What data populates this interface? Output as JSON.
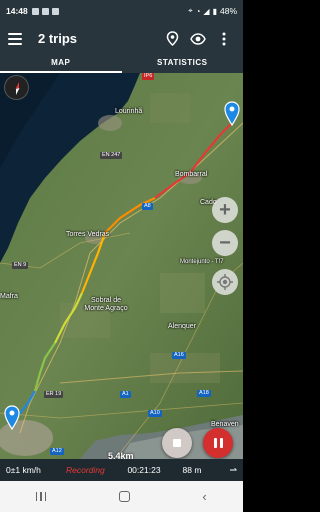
{
  "status_bar": {
    "time": "14:48",
    "battery": "48%"
  },
  "app_bar": {
    "title": "2 trips",
    "icons": [
      "menu-icon",
      "marker-icon",
      "eye-icon",
      "more-vert-icon"
    ]
  },
  "tabs": [
    {
      "label": "MAP",
      "active": true
    },
    {
      "label": "STATISTICS",
      "active": false
    }
  ],
  "map": {
    "labels": {
      "lourinha": "Lourinhã",
      "bombarral": "Bombarral",
      "cado": "Cado",
      "torres_vedras": "Torres Vedras",
      "montejunto": "Montejunto - T!7",
      "sobral": "Sobral de Monte Agraço",
      "alenquer": "Alenquer",
      "mafra": "Mafra",
      "benavente": "Benaven"
    },
    "road_shields": {
      "ip6": "IP6",
      "en247": "EN 247",
      "a8": "A8",
      "en9": "EN 9",
      "a16": "A16",
      "a18": "A18",
      "er19": "ER 19",
      "a1": "A1",
      "a10": "A10",
      "a12": "A12"
    },
    "scale": "5.4km",
    "track_colors": [
      "#2196f3",
      "#8bc34a",
      "#cddc39",
      "#ff9800",
      "#e53935",
      "#c62828"
    ]
  },
  "controls": {
    "zoom_in": "+",
    "zoom_out": "−"
  },
  "info_bar": {
    "speed": "0±1 km/h",
    "status": "Recording",
    "elapsed": "00:21:23",
    "distance": "88 m"
  }
}
